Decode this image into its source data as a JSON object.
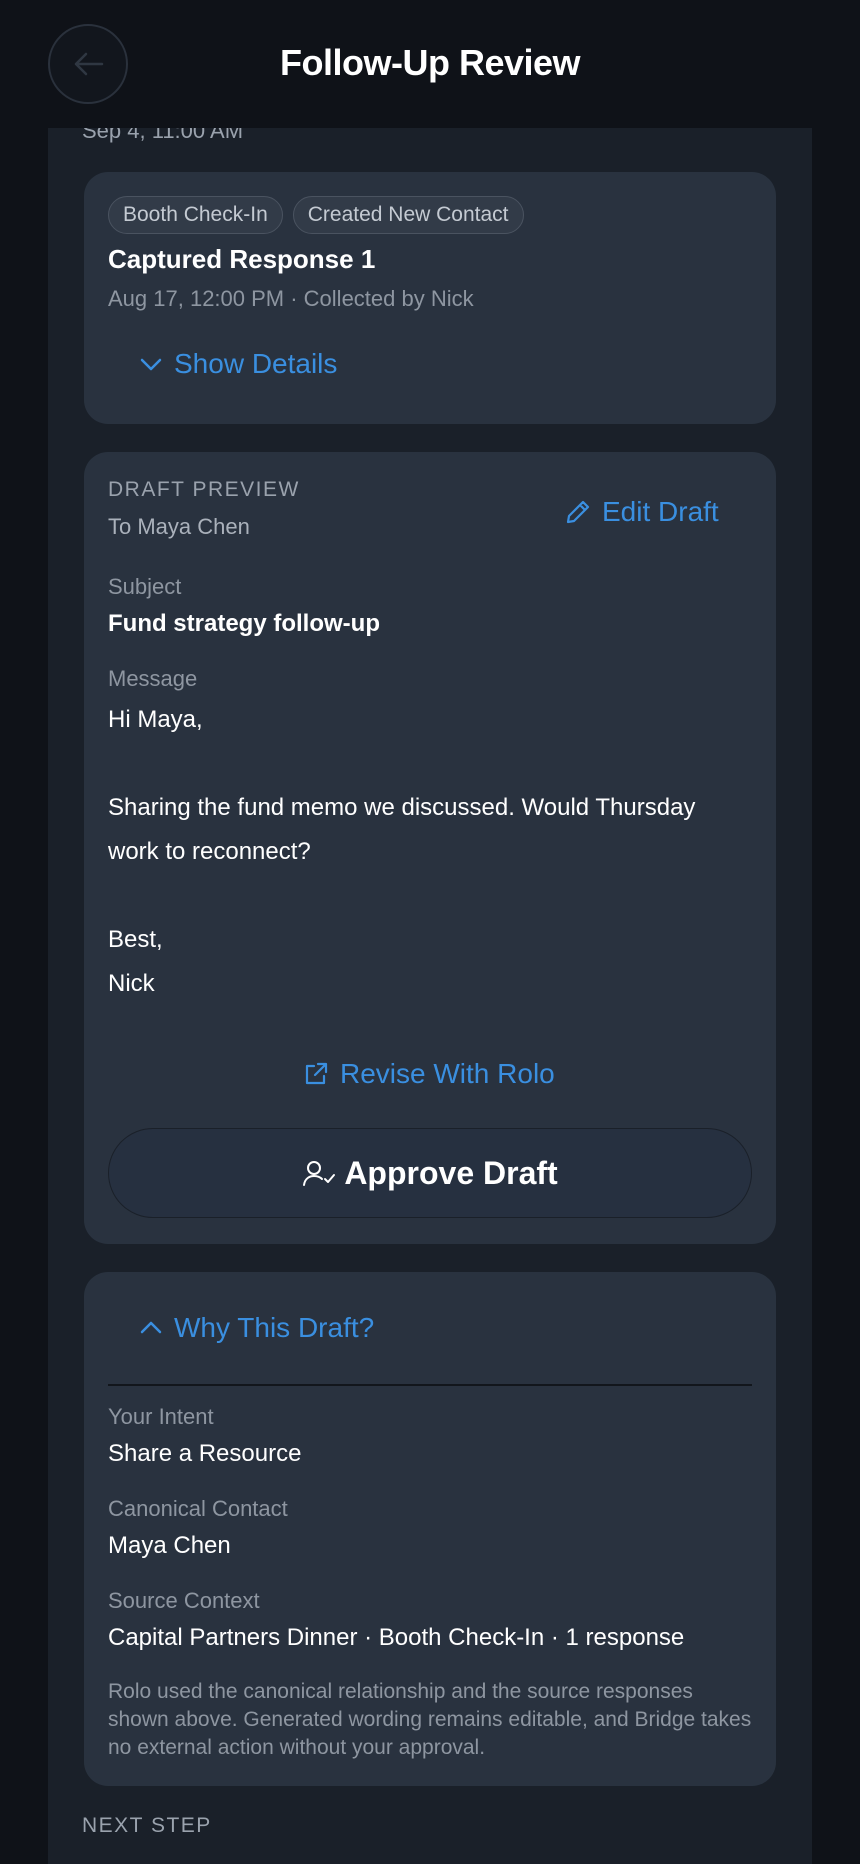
{
  "header": {
    "title": "Follow-Up Review"
  },
  "section_date": "Sep 4, 11:00 AM",
  "response_card": {
    "chips": [
      "Booth Check-In",
      "Created New Contact"
    ],
    "title": "Captured Response 1",
    "meta": "Aug 17, 12:00 PM · Collected by Nick",
    "show_details_label": "Show Details"
  },
  "draft_card": {
    "preview_label": "DRAFT PREVIEW",
    "to": "To Maya Chen",
    "edit_label": "Edit Draft",
    "subject_label": "Subject",
    "subject": "Fund strategy follow-up",
    "message_label": "Message",
    "message_lines": [
      "Hi Maya,",
      "Sharing the fund memo we discussed. Would Thursday",
      "work to reconnect?",
      "Best,",
      "Nick"
    ],
    "revise_label": "Revise With Rolo",
    "approve_label": "Approve Draft"
  },
  "why_card": {
    "toggle_label": "Why This Draft?",
    "intent_label": "Your Intent",
    "intent": "Share a Resource",
    "contact_label": "Canonical Contact",
    "contact": "Maya Chen",
    "source_label": "Source Context",
    "source": "Capital Partners Dinner · Booth Check-In · 1 response",
    "note": "Rolo used the canonical relationship and the source responses shown above. Generated wording remains editable, and Bridge takes no external action without your approval."
  },
  "next_step_label": "NEXT STEP",
  "colors": {
    "accent": "#3a8fe0",
    "card": "#29323f",
    "background": "#0f1218"
  }
}
